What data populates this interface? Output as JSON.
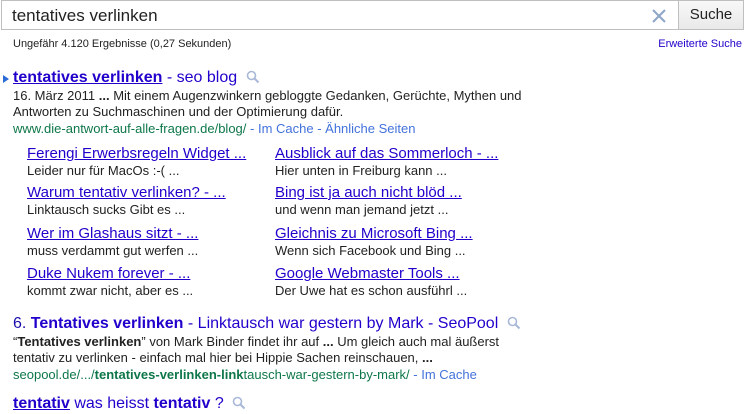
{
  "search": {
    "query": "tentatives verlinken",
    "button_label": "Suche",
    "stats": "Ungefähr 4.120 Ergebnisse (0,27 Sekunden)",
    "advanced": "Erweiterte Suche"
  },
  "result1": {
    "title_bold": "tentatives verlinken",
    "title_rest": " - seo blog",
    "snippet_date": "16. März 2011",
    "snippet_ellipsis": " ... ",
    "snippet_text": "Mit einem Augenzwinkern gebloggte Gedanken, Gerüchte, Mythen und Antworten zu Suchmaschinen und der Optimierung dafür.",
    "url": "www.die-antwort-auf-alle-fragen.de/blog/",
    "cache": " - Im Cache - Ähnliche Seiten",
    "sitelinks": [
      {
        "title": "Ferengi Erwerbsregeln Widget ...",
        "desc": "Leider nur für MacOs :-( ..."
      },
      {
        "title": "Ausblick auf das Sommerloch - ...",
        "desc": "Hier unten in Freiburg kann ..."
      },
      {
        "title": "Warum tentativ verlinken? - ...",
        "desc": "Linktausch sucks Gibt es ..."
      },
      {
        "title": "Bing ist ja auch nicht blöd ...",
        "desc": "und wenn man jemand jetzt ..."
      },
      {
        "title": "Wer im Glashaus sitzt - ...",
        "desc": "muss verdammt gut werfen ..."
      },
      {
        "title": "Gleichnis zu Microsoft Bing ...",
        "desc": "Wenn sich Facebook und Bing ..."
      },
      {
        "title": "Duke Nukem forever - ...",
        "desc": "kommt zwar nicht, aber es ..."
      },
      {
        "title": "Google Webmaster Tools ...",
        "desc": "Der Uwe hat es schon ausführl ..."
      }
    ]
  },
  "result2": {
    "number": "6. ",
    "title_bold": "Tentatives verlinken",
    "title_rest": " - Linktausch war gestern by Mark - SeoPool",
    "snippet_q1": "“",
    "snippet_b1": "Tentatives verlinken",
    "snippet_q2": "” von Mark Binder findet ihr auf ",
    "snippet_ell": "...",
    "snippet_rest": " Um gleich auch mal äußerst tentativ zu verlinken - einfach mal hier bei Hippie Sachen reinschauen, ",
    "snippet_end": "...",
    "url_pre": "seopool.de/.../",
    "url_bold": "tentatives-verlinken-link",
    "url_post": "tausch-war-gestern-by-mark/",
    "cache": " - Im Cache"
  },
  "result3": {
    "title_b1": "tentativ",
    "title_mid": " was heisst ",
    "title_b2": "tentativ",
    "title_end": " ?"
  },
  "colors": {
    "link": "#2200cc",
    "url": "#0e774a",
    "cache": "#4272db"
  }
}
